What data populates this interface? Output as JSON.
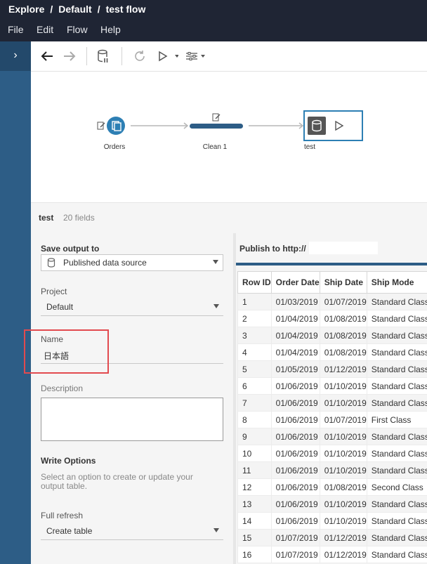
{
  "breadcrumb": [
    "Explore",
    "Default",
    "test flow"
  ],
  "breadcrumb_separator": "/",
  "menu": [
    "File",
    "Edit",
    "Flow",
    "Help"
  ],
  "sidebar_toggle": "›",
  "flow": {
    "nodes": [
      {
        "label": "Orders",
        "type": "input"
      },
      {
        "label": "Clean 1",
        "type": "clean"
      },
      {
        "label": "test",
        "type": "output"
      }
    ]
  },
  "output": {
    "name": "test",
    "field_count": "20 fields",
    "save_output_label": "Save output to",
    "save_output_value": "Published data source",
    "project_label": "Project",
    "project_value": "Default",
    "name_label": "Name",
    "name_value": "日本語",
    "description_label": "Description",
    "write_options_label": "Write Options",
    "write_options_help": "Select an option to create or update your output table.",
    "refresh_label": "Full refresh",
    "refresh_value": "Create table"
  },
  "preview": {
    "publish_label": "Publish to http://",
    "columns": [
      "Row ID",
      "Order Date",
      "Ship Date",
      "Ship Mode"
    ],
    "rows": [
      [
        "1",
        "01/03/2019",
        "01/07/2019",
        "Standard Class"
      ],
      [
        "2",
        "01/04/2019",
        "01/08/2019",
        "Standard Class"
      ],
      [
        "3",
        "01/04/2019",
        "01/08/2019",
        "Standard Class"
      ],
      [
        "4",
        "01/04/2019",
        "01/08/2019",
        "Standard Class"
      ],
      [
        "5",
        "01/05/2019",
        "01/12/2019",
        "Standard Class"
      ],
      [
        "6",
        "01/06/2019",
        "01/10/2019",
        "Standard Class"
      ],
      [
        "7",
        "01/06/2019",
        "01/10/2019",
        "Standard Class"
      ],
      [
        "8",
        "01/06/2019",
        "01/07/2019",
        "First Class"
      ],
      [
        "9",
        "01/06/2019",
        "01/10/2019",
        "Standard Class"
      ],
      [
        "10",
        "01/06/2019",
        "01/10/2019",
        "Standard Class"
      ],
      [
        "11",
        "01/06/2019",
        "01/10/2019",
        "Standard Class"
      ],
      [
        "12",
        "01/06/2019",
        "01/08/2019",
        "Second Class"
      ],
      [
        "13",
        "01/06/2019",
        "01/10/2019",
        "Standard Class"
      ],
      [
        "14",
        "01/06/2019",
        "01/10/2019",
        "Standard Class"
      ],
      [
        "15",
        "01/07/2019",
        "01/12/2019",
        "Standard Class"
      ],
      [
        "16",
        "01/07/2019",
        "01/12/2019",
        "Standard Class"
      ]
    ]
  },
  "colors": {
    "title_bar": "#1f2534",
    "accent": "#2d5d86",
    "highlight": "#e24a4f"
  }
}
